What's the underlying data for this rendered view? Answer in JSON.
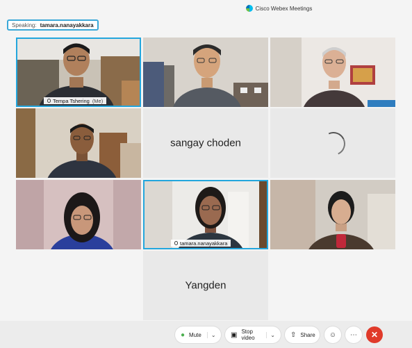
{
  "window": {
    "title": "Cisco Webex Meetings",
    "icon": "webex-logo"
  },
  "speaking": {
    "label": "Speaking:",
    "name": "tamara.nanayakkara"
  },
  "participants": [
    {
      "name": "Tempa Tshering",
      "suffix": "(Me)",
      "video": true
    },
    {
      "name": "",
      "video": true
    },
    {
      "name": "",
      "video": true
    },
    {
      "name": "",
      "video": true
    },
    {
      "name": "sangay choden",
      "video": false
    },
    {
      "name": "",
      "video": false,
      "state": "loading"
    },
    {
      "name": "",
      "video": true
    },
    {
      "name": "tamara.nanayakkara",
      "video": true,
      "active_speaker": true
    },
    {
      "name": "",
      "video": true
    },
    {
      "name": "Yangden",
      "video": false
    }
  ],
  "controls": {
    "mute_label": "Mute",
    "stop_video_label": "Stop video",
    "share_label": "Share",
    "mic_icon": "microphone-icon",
    "video_icon": "camera-icon",
    "share_icon": "share-icon",
    "reactions_icon": "smiley-icon",
    "more_icon": "ellipsis-icon",
    "end_icon": "close-icon"
  },
  "colors": {
    "accent": "#23a6dd",
    "end": "#e03a2a",
    "mic": "#4caf50"
  }
}
